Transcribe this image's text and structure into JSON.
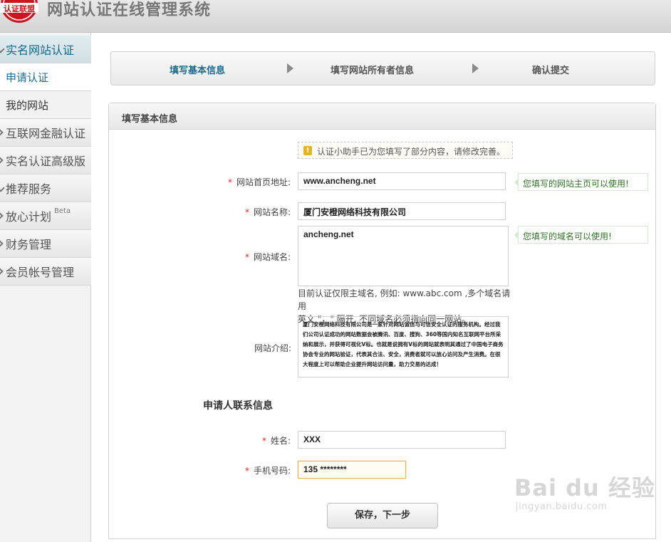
{
  "header": {
    "title": "网站认证在线管理系统",
    "logo_text": "认证联盟"
  },
  "sidebar": {
    "items": [
      {
        "label": "实名网站认证"
      },
      {
        "label": "申请认证"
      },
      {
        "label": "我的网站"
      },
      {
        "label": "互联网金融认证"
      },
      {
        "label": "实名认证高级版"
      },
      {
        "label": "推荐服务"
      },
      {
        "label": "放心计划",
        "badge": "Beta"
      },
      {
        "label": "财务管理"
      },
      {
        "label": "会员帐号管理"
      }
    ]
  },
  "steps": [
    "填写基本信息",
    "填写网站所有者信息",
    "确认提交"
  ],
  "panel": {
    "title": "填写基本信息"
  },
  "hint": {
    "text": "认证小助手已为您填写了部分内容，请修改完善。",
    "icon": "!"
  },
  "form": {
    "homepage": {
      "label": "网站首页地址:",
      "value": "www.ancheng.net",
      "tip": "您填写的网站主页可以使用!"
    },
    "site_name": {
      "label": "网站名称:",
      "value": "厦门安橙网络科技有限公司"
    },
    "domain": {
      "label": "网站域名:",
      "value": "ancheng.net",
      "tip": "您填写的域名可以使用!",
      "note_line1": "目前认证仅限主域名, 例如: www.abc.com ,多个域名请用",
      "note_line2": "英文 \"，\" 隔开, 不同域名必须指向同一网站。"
    },
    "intro": {
      "label": "网站介绍:",
      "value": "厦门安橙网络科技有限公司是一家针对网站诚信与可信安全认证的服务机构。经过我们公司认证成功的网站数据会被腾讯、百度、搜狗、360等国内知名互联网平台所采纳和展示，并获得可视化V标。也就是说拥有V标的网站就表明其通过了中国电子商务协会专业的网站验证，代表其合法、安全，消费者就可以放心访问及产生消费。在很大程度上可以帮助企业提升网站访问量，助力交易的达成！"
    },
    "contact_title": "申请人联系信息",
    "name": {
      "label": "姓名:",
      "value": "XXX"
    },
    "phone": {
      "label": "手机号码:",
      "value": "135 ********"
    },
    "required_mark": "*",
    "submit_label": "保存，下一步"
  },
  "watermark": {
    "brand": "Bai du 经验",
    "url": "jingyan.baidu.com"
  },
  "colors": {
    "accent": "#1b6a8a",
    "required": "#dd2222",
    "success": "#33702a"
  }
}
